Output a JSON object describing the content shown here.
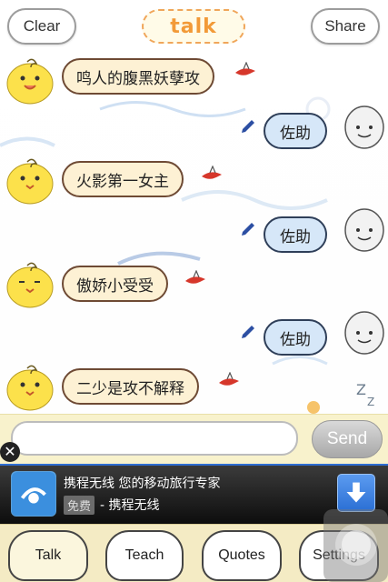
{
  "header": {
    "clear_label": "Clear",
    "title": "talk",
    "share_label": "Share"
  },
  "chat": {
    "messages": [
      {
        "side": "left",
        "text": "鸣人的腹黑妖孽攻"
      },
      {
        "side": "right",
        "text": "佐助"
      },
      {
        "side": "left",
        "text": "火影第一女主"
      },
      {
        "side": "right",
        "text": "佐助"
      },
      {
        "side": "left",
        "text": "傲娇小受受"
      },
      {
        "side": "right",
        "text": "佐助"
      },
      {
        "side": "left",
        "text": "二少是攻不解释"
      }
    ]
  },
  "input": {
    "placeholder": "",
    "value": "",
    "send_label": "Send"
  },
  "ad": {
    "title": "携程无线 您的移动旅行专家",
    "tag": "免费",
    "subtitle": "- 携程无线"
  },
  "tabs": [
    {
      "label": "Talk"
    },
    {
      "label": "Teach"
    },
    {
      "label": "Quotes"
    },
    {
      "label": "Settings"
    }
  ],
  "colors": {
    "accent": "#f29a38",
    "bubble_left": "#fdf1d4",
    "bubble_right": "#d6e7f8",
    "tabbar": "#f4ebc4"
  }
}
